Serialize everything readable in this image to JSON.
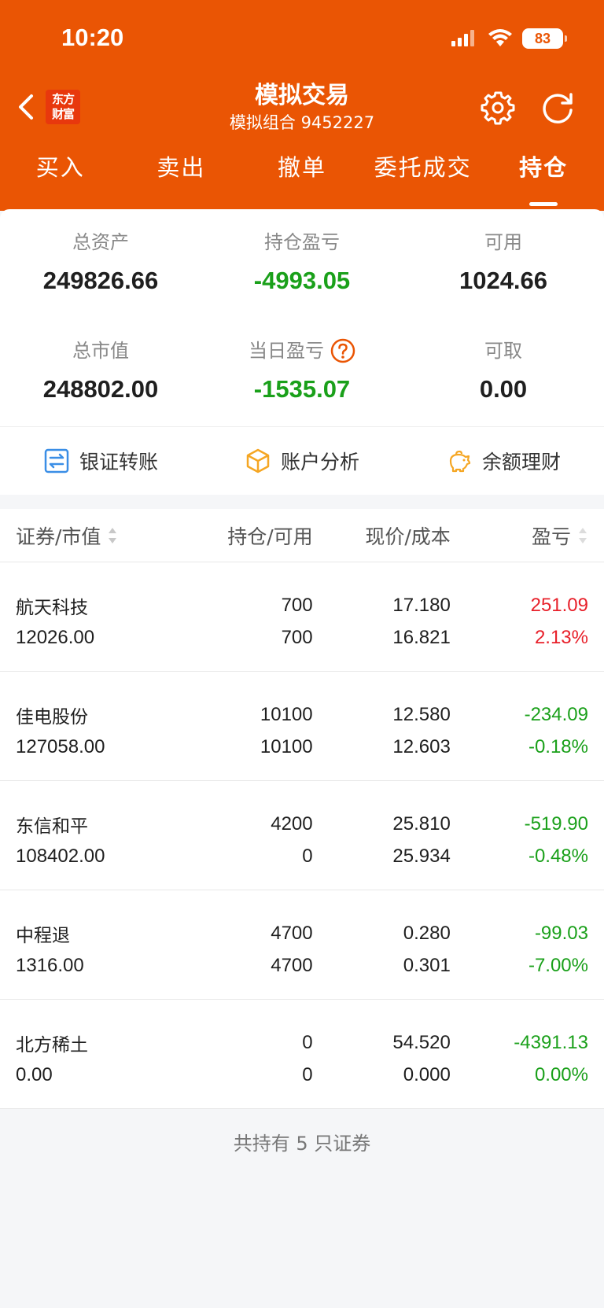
{
  "status": {
    "time": "10:20",
    "battery": "83"
  },
  "nav": {
    "logo_line1": "东方",
    "logo_line2": "财富",
    "title": "模拟交易",
    "subtitle": "模拟组合 9452227"
  },
  "tabs": [
    {
      "label": "买入"
    },
    {
      "label": "卖出"
    },
    {
      "label": "撤单"
    },
    {
      "label": "委托成交"
    },
    {
      "label": "持仓"
    }
  ],
  "summary": {
    "total_assets": {
      "label": "总资产",
      "value": "249826.66"
    },
    "position_pnl": {
      "label": "持仓盈亏",
      "value": "-4993.05"
    },
    "available": {
      "label": "可用",
      "value": "1024.66"
    },
    "market_value": {
      "label": "总市值",
      "value": "248802.00"
    },
    "daily_pnl": {
      "label": "当日盈亏",
      "value": "-1535.07"
    },
    "withdrawable": {
      "label": "可取",
      "value": "0.00"
    }
  },
  "tools": {
    "transfer": "银证转账",
    "analysis": "账户分析",
    "wealth": "余额理财"
  },
  "table": {
    "headers": {
      "security": "证券/市值",
      "position": "持仓/可用",
      "price": "现价/成本",
      "pnl": "盈亏"
    },
    "rows": [
      {
        "name": "航天科技",
        "market_value": "12026.00",
        "position": "700",
        "available": "700",
        "price": "17.180",
        "cost": "16.821",
        "pnl": "251.09",
        "pnl_pct": "2.13%",
        "color": "#e8202a"
      },
      {
        "name": "佳电股份",
        "market_value": "127058.00",
        "position": "10100",
        "available": "10100",
        "price": "12.580",
        "cost": "12.603",
        "pnl": "-234.09",
        "pnl_pct": "-0.18%",
        "color": "#1aa01a"
      },
      {
        "name": "东信和平",
        "market_value": "108402.00",
        "position": "4200",
        "available": "0",
        "price": "25.810",
        "cost": "25.934",
        "pnl": "-519.90",
        "pnl_pct": "-0.48%",
        "color": "#1aa01a"
      },
      {
        "name": "中程退",
        "market_value": "1316.00",
        "position": "4700",
        "available": "4700",
        "price": "0.280",
        "cost": "0.301",
        "pnl": "-99.03",
        "pnl_pct": "-7.00%",
        "color": "#1aa01a"
      },
      {
        "name": "北方稀土",
        "market_value": "0.00",
        "position": "0",
        "available": "0",
        "price": "54.520",
        "cost": "0.000",
        "pnl": "-4391.13",
        "pnl_pct": "0.00%",
        "color": "#1aa01a"
      }
    ]
  },
  "footer": "共持有 5 只证券",
  "colors": {
    "brand": "#ea5504",
    "up": "#e8202a",
    "down": "#1aa01a"
  }
}
